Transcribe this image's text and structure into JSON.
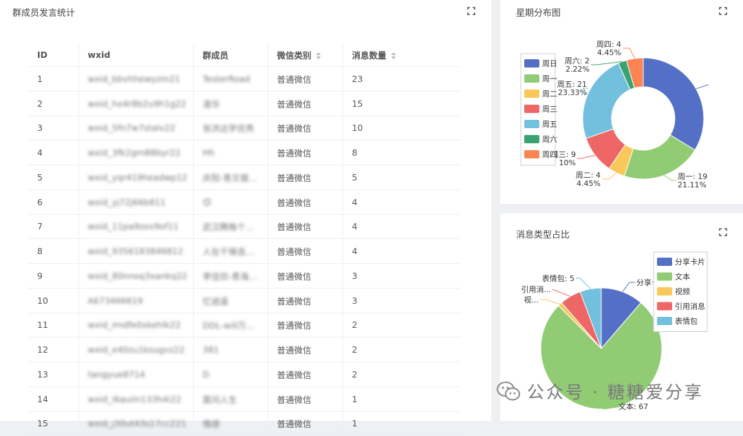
{
  "members_panel": {
    "title": "群成员发言统计",
    "columns": [
      "ID",
      "wxid",
      "群成员",
      "微信类别",
      "消息数量"
    ],
    "rows": [
      {
        "id": "1",
        "wxid": "wxid_bbvhhewyzm21",
        "member": "TesterRoad",
        "type": "普通微信",
        "count": "23"
      },
      {
        "id": "2",
        "wxid": "wxid_ho4r8b2u9h1g22",
        "member": "清华",
        "type": "普通微信",
        "count": "15"
      },
      {
        "id": "3",
        "wxid": "wxid_5fn7w7stalv22",
        "member": "张洪达学优秀",
        "type": "普通微信",
        "count": "10"
      },
      {
        "id": "4",
        "wxid": "wxid_3fk2gm88byr22",
        "member": "Hh",
        "type": "普通微信",
        "count": "8"
      },
      {
        "id": "5",
        "wxid": "wxid_yqr419headwp12",
        "member": "庆阳-青文银...",
        "type": "普通微信",
        "count": "5"
      },
      {
        "id": "6",
        "wxid": "wxid_yj72j66b811",
        "member": "😊",
        "type": "普通微信",
        "count": "4"
      },
      {
        "id": "7",
        "wxid": "wxid_11pa9zov9of11",
        "member": "武汉腾格个...",
        "type": "普通微信",
        "count": "4"
      },
      {
        "id": "8",
        "wxid": "wxid_9356183846812",
        "member": "人在千锋造...",
        "type": "普通微信",
        "count": "4"
      },
      {
        "id": "9",
        "wxid": "wxid_80nnoq3xankq22",
        "member": "李佳欣-青海...",
        "type": "普通微信",
        "count": "3"
      },
      {
        "id": "10",
        "wxid": "A673466619",
        "member": "忆逍遥",
        "type": "普通微信",
        "count": "3"
      },
      {
        "id": "11",
        "wxid": "wxid_imdfe0xkehlk22",
        "member": "DDL-will万...",
        "type": "普通微信",
        "count": "2"
      },
      {
        "id": "12",
        "wxid": "wxid_e40zu1ksugvz22",
        "member": "381",
        "type": "普通微信",
        "count": "2"
      },
      {
        "id": "13",
        "wxid": "tangyue8714",
        "member": "D",
        "type": "普通微信",
        "count": "2"
      },
      {
        "id": "14",
        "wxid": "wxid_i6auiin133h4i22",
        "member": "莫问人生",
        "type": "普通微信",
        "count": "1"
      },
      {
        "id": "15",
        "wxid": "wxid_j30ut43s17cc221",
        "member": "情感",
        "type": "普通微信",
        "count": "1"
      }
    ]
  },
  "week_panel": {
    "title": "星期分布图"
  },
  "msgtype_panel": {
    "title": "消息类型占比"
  },
  "watermark": {
    "text": "公众号 · 糖糖爱分享"
  },
  "chart_data": [
    {
      "type": "pie",
      "variant": "donut",
      "title": "星期分布图",
      "legend_position": "top-left",
      "categories": [
        "周日",
        "周一",
        "周二",
        "周三",
        "周五",
        "周六",
        "周四"
      ],
      "values": [
        30,
        19,
        4,
        9,
        21,
        2,
        4
      ],
      "colors": [
        "#5470c6",
        "#91cc75",
        "#fac858",
        "#ee6666",
        "#73c0de",
        "#3ba272",
        "#fc8452"
      ],
      "labels": [
        {
          "name": "周一",
          "value_text": "周一: 19",
          "pct_text": "21.11%"
        },
        {
          "name": "周二",
          "value_text": "周二: 4",
          "pct_text": "4.45%"
        },
        {
          "name": "周三",
          "value_text": "周三: 9",
          "pct_text": "10%"
        },
        {
          "name": "周五",
          "value_text": "周五: 21",
          "pct_text": "23.33%"
        },
        {
          "name": "周六",
          "value_text": "周六: 2",
          "pct_text": "2.22%"
        },
        {
          "name": "周四",
          "value_text": "周四: 4",
          "pct_text": "4.45%"
        }
      ]
    },
    {
      "type": "pie",
      "title": "消息类型占比",
      "legend_position": "top-right",
      "categories": [
        "分享卡片",
        "文本",
        "视频",
        "引用消息",
        "表情包"
      ],
      "values": [
        10,
        67,
        1,
        5,
        5
      ],
      "colors": [
        "#5470c6",
        "#91cc75",
        "#fac858",
        "#ee6666",
        "#73c0de"
      ],
      "labels": [
        {
          "name": "分享卡片",
          "text": "分享卡片: 10"
        },
        {
          "name": "文本",
          "text": "文本: 67"
        },
        {
          "name": "视频",
          "text": "视..."
        },
        {
          "name": "引用消息",
          "text": "引用消..."
        },
        {
          "name": "表情包",
          "text": "表情包: 5"
        }
      ]
    }
  ]
}
